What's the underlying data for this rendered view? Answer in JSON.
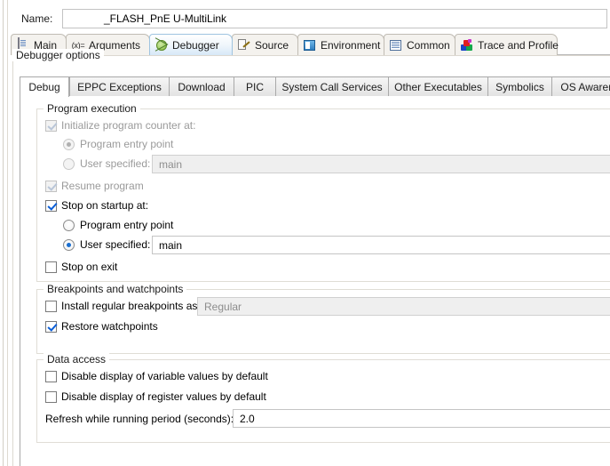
{
  "window": {
    "name_label": "Name:",
    "name_value": "_FLASH_PnE U-MultiLink"
  },
  "outer_tabs": [
    {
      "label": "Main",
      "icon": "document-icon",
      "selected": false
    },
    {
      "label": "Arguments",
      "icon": "arguments-icon",
      "selected": false
    },
    {
      "label": "Debugger",
      "icon": "bug-icon",
      "selected": true
    },
    {
      "label": "Source",
      "icon": "source-edit-icon",
      "selected": false
    },
    {
      "label": "Environment",
      "icon": "environment-icon",
      "selected": false
    },
    {
      "label": "Common",
      "icon": "common-list-icon",
      "selected": false
    },
    {
      "label": "Trace and Profile",
      "icon": "trace-icon",
      "selected": false
    }
  ],
  "group_title": "Debugger options",
  "inner_tabs": [
    {
      "label": "Debug",
      "selected": true
    },
    {
      "label": "EPPC Exceptions",
      "selected": false
    },
    {
      "label": "Download",
      "selected": false
    },
    {
      "label": "PIC",
      "selected": false
    },
    {
      "label": "System Call Services",
      "selected": false
    },
    {
      "label": "Other Executables",
      "selected": false
    },
    {
      "label": "Symbolics",
      "selected": false
    },
    {
      "label": "OS Awareness",
      "selected": false
    }
  ],
  "program_execution": {
    "title": "Program execution",
    "init_pc": {
      "label": "Initialize program counter at:",
      "checked": true,
      "enabled": false
    },
    "init_entry": {
      "label": "Program entry point",
      "selected": true,
      "enabled": false
    },
    "init_user": {
      "label": "User specified:",
      "selected": false,
      "enabled": false
    },
    "init_user_value": "main",
    "resume": {
      "label": "Resume program",
      "checked": true,
      "enabled": false
    },
    "stop_startup": {
      "label": "Stop on startup at:",
      "checked": true,
      "enabled": true
    },
    "stop_entry": {
      "label": "Program entry point",
      "selected": false,
      "enabled": true
    },
    "stop_user": {
      "label": "User specified:",
      "selected": true,
      "enabled": true
    },
    "stop_user_value": "main",
    "stop_exit": {
      "label": "Stop on exit",
      "checked": false,
      "enabled": true
    }
  },
  "breakpoints": {
    "title": "Breakpoints and watchpoints",
    "install": {
      "label": "Install regular breakpoints as",
      "checked": false,
      "enabled": true
    },
    "install_value": "Regular",
    "restore": {
      "label": "Restore watchpoints",
      "checked": true,
      "enabled": true
    }
  },
  "data_access": {
    "title": "Data access",
    "disable_var": {
      "label": "Disable display of variable values by default",
      "checked": false,
      "enabled": true
    },
    "disable_reg": {
      "label": "Disable display of register values by default",
      "checked": false,
      "enabled": true
    },
    "refresh_label": "Refresh while running period (seconds):",
    "refresh_value": "2.0"
  }
}
